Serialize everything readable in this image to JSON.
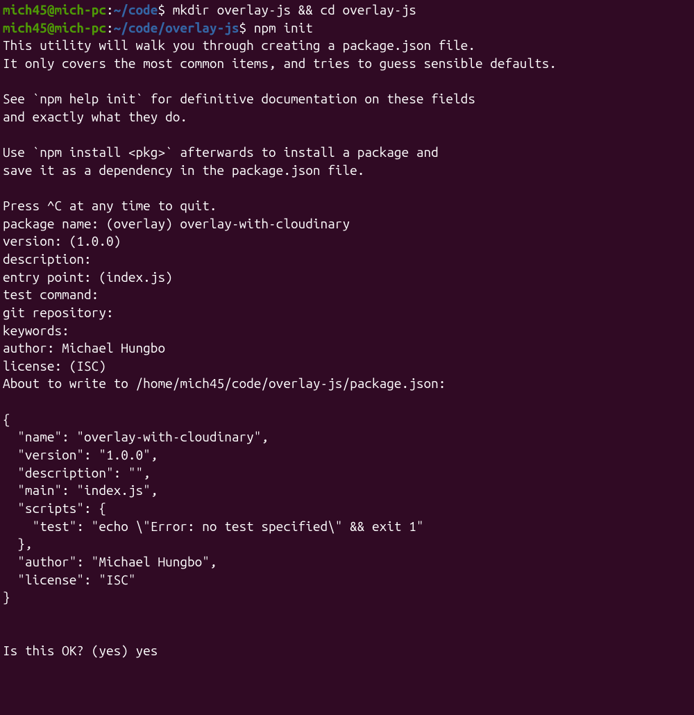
{
  "lines": [
    {
      "user": "mich45@mich-pc",
      "sep": ":",
      "path": "~/code",
      "dollar": "$ ",
      "cmd": "mkdir overlay-js && cd overlay-js"
    },
    {
      "user": "mich45@mich-pc",
      "sep": ":",
      "path": "~/code/overlay-js",
      "dollar": "$ ",
      "cmd": "npm init"
    }
  ],
  "output": {
    "l1": "This utility will walk you through creating a package.json file.",
    "l2": "It only covers the most common items, and tries to guess sensible defaults.",
    "l3": "See `npm help init` for definitive documentation on these fields",
    "l4": "and exactly what they do.",
    "l5": "Use `npm install <pkg>` afterwards to install a package and",
    "l6": "save it as a dependency in the package.json file.",
    "l7": "Press ^C at any time to quit.",
    "l8": "About to write to /home/mich45/code/overlay-js/package.json:"
  },
  "prompts": {
    "package_name": "package name: (overlay) overlay-with-cloudinary",
    "version": "version: (1.0.0) ",
    "description": "description: ",
    "entry_point": "entry point: (index.js) ",
    "test_command": "test command: ",
    "git_repository": "git repository: ",
    "keywords": "keywords: ",
    "author": "author: Michael Hungbo",
    "license": "license: (ISC) ",
    "is_ok": "Is this OK? (yes) yes"
  },
  "json": {
    "l1": "{",
    "l2": "  \"name\": \"overlay-with-cloudinary\",",
    "l3": "  \"version\": \"1.0.0\",",
    "l4": "  \"description\": \"\",",
    "l5": "  \"main\": \"index.js\",",
    "l6": "  \"scripts\": {",
    "l7": "    \"test\": \"echo \\\"Error: no test specified\\\" && exit 1\"",
    "l8": "  },",
    "l9": "  \"author\": \"Michael Hungbo\",",
    "l10": "  \"license\": \"ISC\"",
    "l11": "}"
  }
}
